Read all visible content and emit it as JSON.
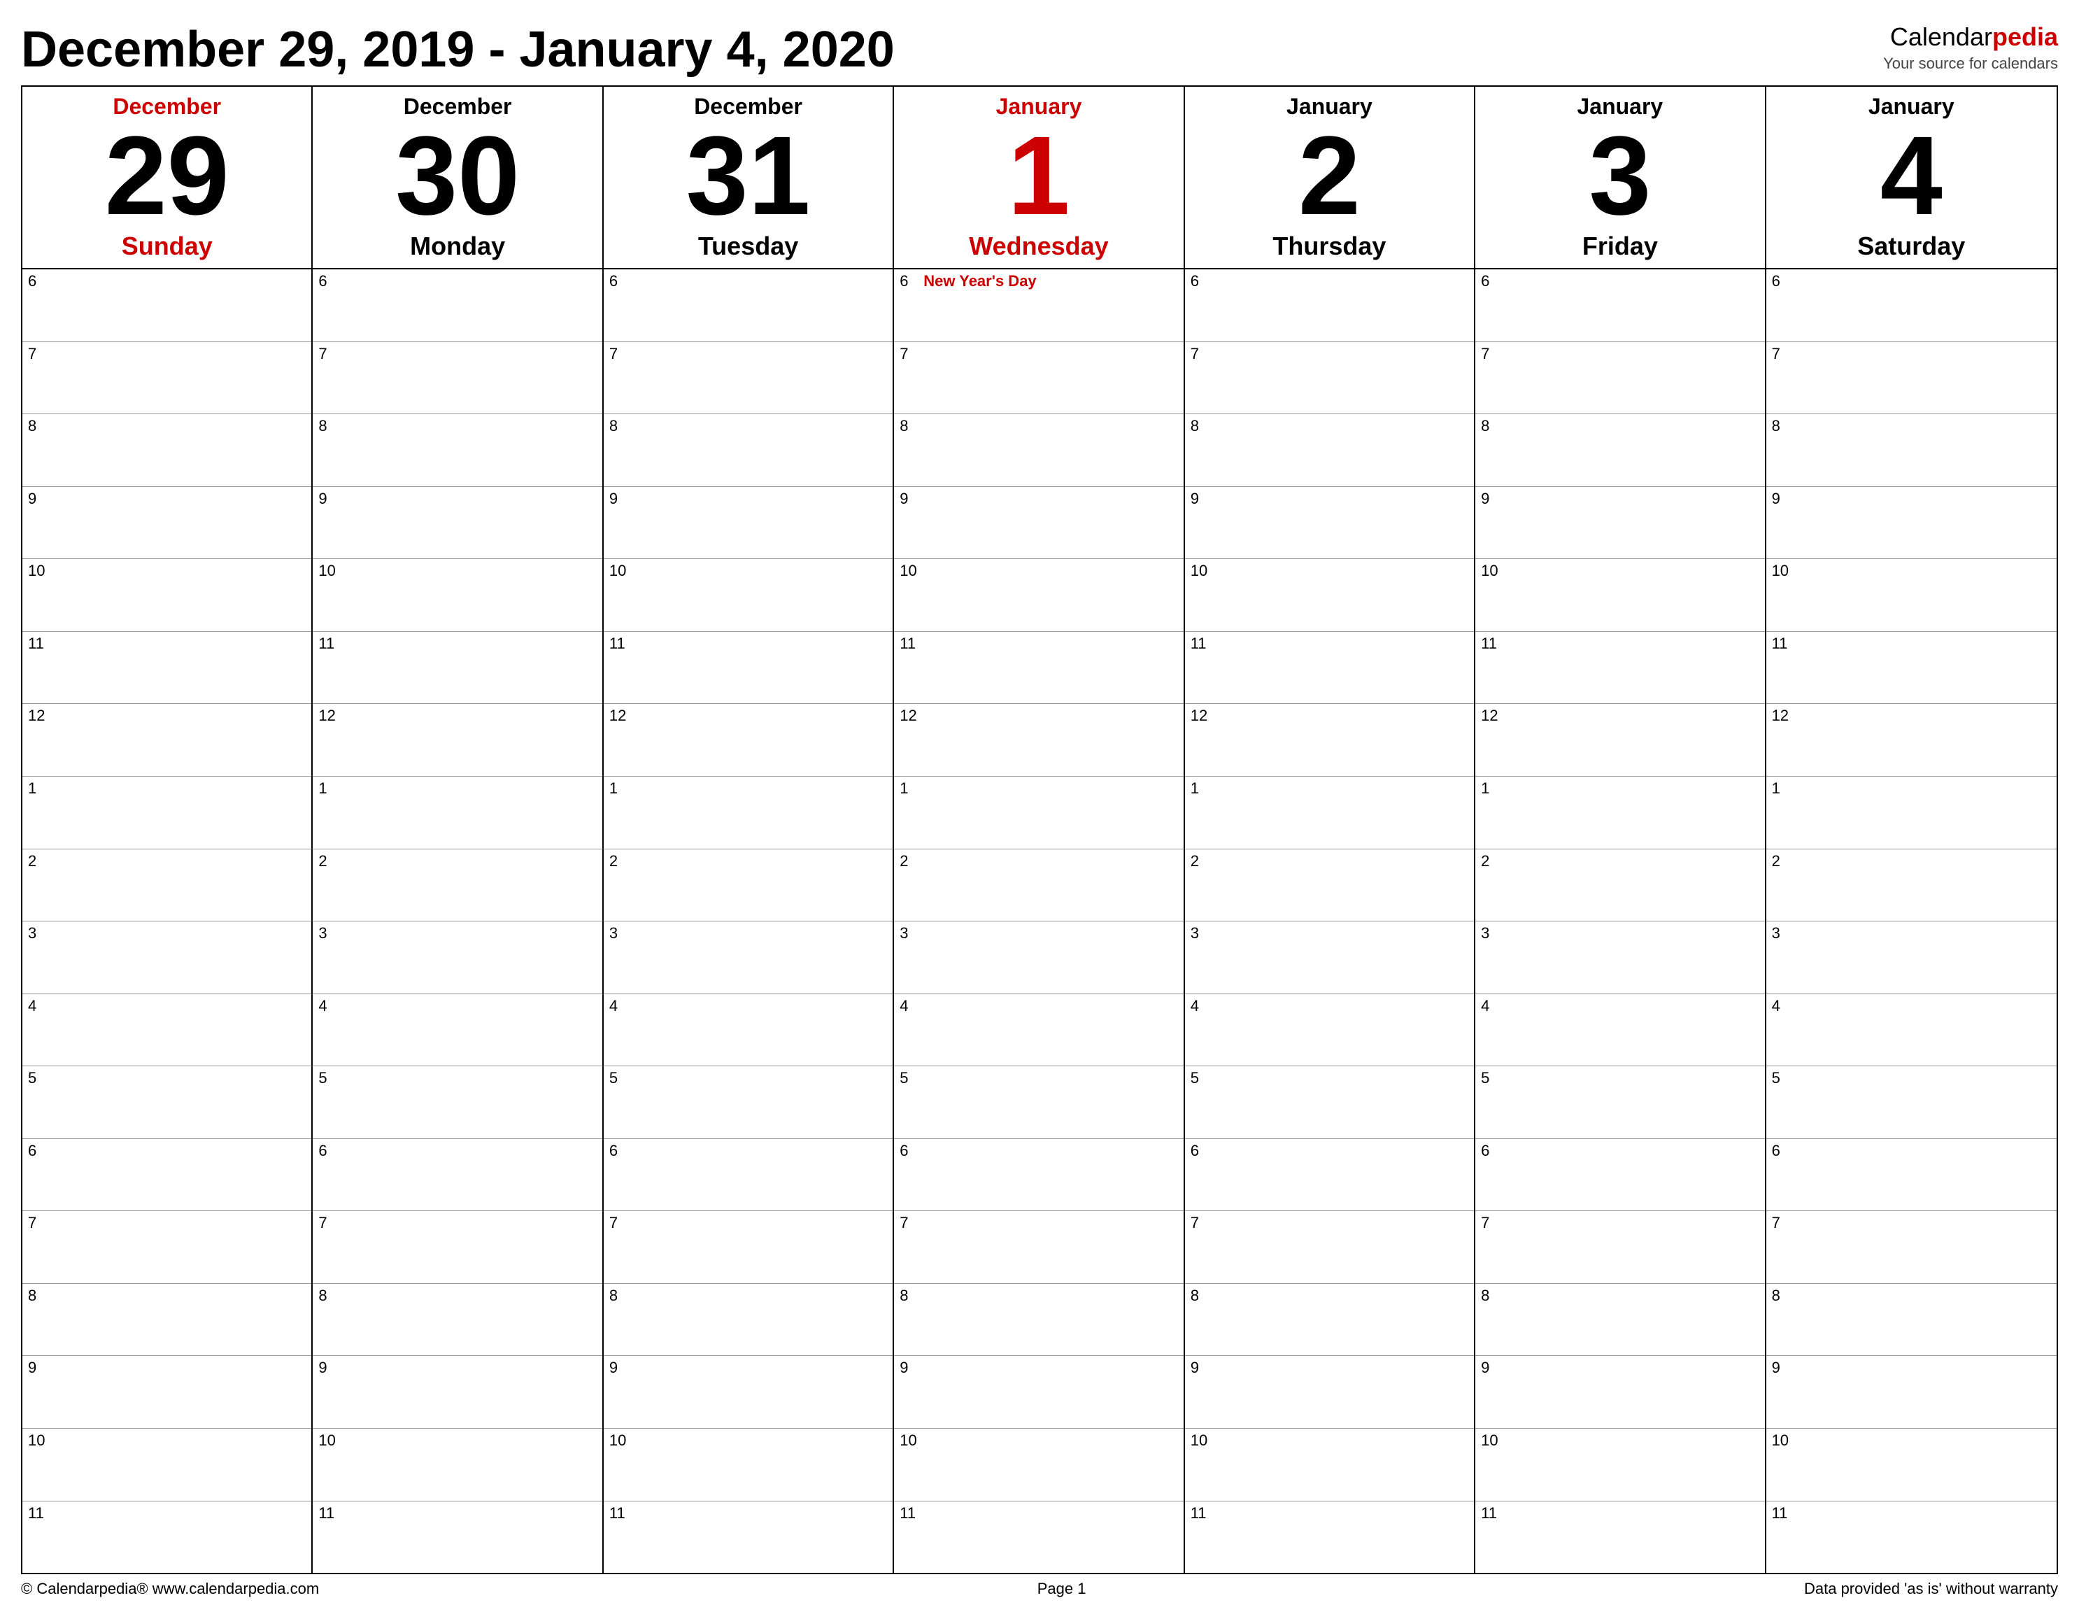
{
  "header": {
    "title": "December 29, 2019 - January 4, 2020",
    "logo_text": "Calendar",
    "logo_emphasis": "pedia",
    "logo_tagline": "Your source for calendars"
  },
  "days": [
    {
      "id": "dec29",
      "month": "December",
      "number": "29",
      "name": "Sunday",
      "is_today": false,
      "is_sunday": true,
      "is_saturday": false
    },
    {
      "id": "dec30",
      "month": "December",
      "number": "30",
      "name": "Monday",
      "is_today": false,
      "is_sunday": false,
      "is_saturday": false
    },
    {
      "id": "dec31",
      "month": "December",
      "number": "31",
      "name": "Tuesday",
      "is_today": false,
      "is_sunday": false,
      "is_saturday": false
    },
    {
      "id": "jan1",
      "month": "January",
      "number": "1",
      "name": "Wednesday",
      "is_today": true,
      "is_sunday": false,
      "is_saturday": false,
      "holiday": "New Year's Day"
    },
    {
      "id": "jan2",
      "month": "January",
      "number": "2",
      "name": "Thursday",
      "is_today": false,
      "is_sunday": false,
      "is_saturday": false
    },
    {
      "id": "jan3",
      "month": "January",
      "number": "3",
      "name": "Friday",
      "is_today": false,
      "is_sunday": false,
      "is_saturday": false
    },
    {
      "id": "jan4",
      "month": "January",
      "number": "4",
      "name": "Saturday",
      "is_today": false,
      "is_sunday": false,
      "is_saturday": true
    }
  ],
  "time_slots": [
    "6",
    "7",
    "8",
    "9",
    "10",
    "11",
    "12",
    "1",
    "2",
    "3",
    "4",
    "5",
    "6",
    "7",
    "8",
    "9",
    "10",
    "11"
  ],
  "footer": {
    "left": "© Calendarpedia®   www.calendarpedia.com",
    "center": "Page 1",
    "right": "Data provided 'as is' without warranty"
  }
}
